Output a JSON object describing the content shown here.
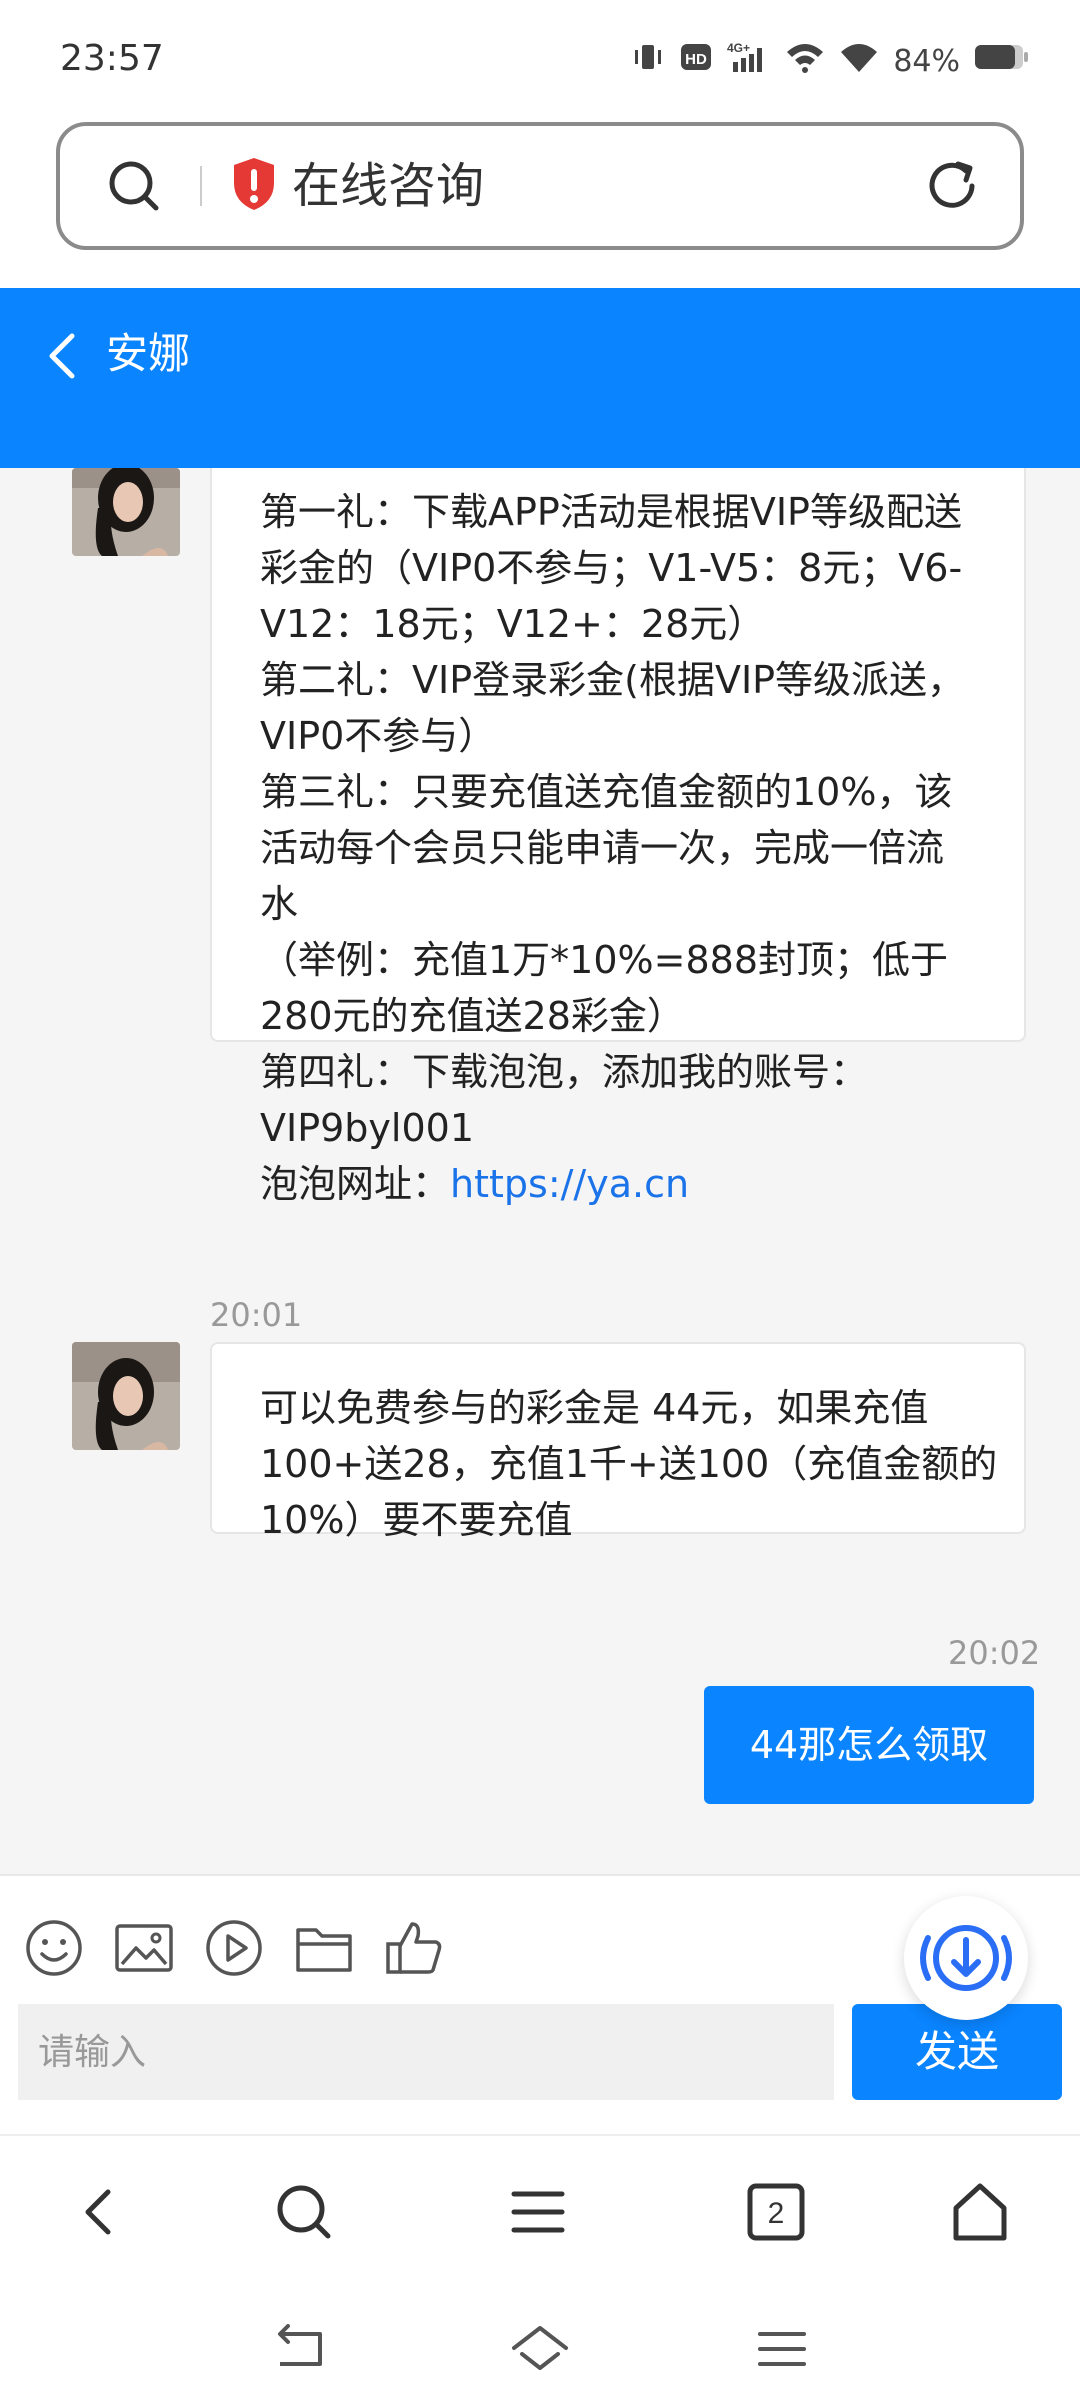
{
  "status_bar": {
    "time": "23:57",
    "battery": "84%",
    "network": "4G+",
    "hd": "HD"
  },
  "address_bar": {
    "title": "在线咨询"
  },
  "header": {
    "agent_name": "安娜"
  },
  "messages": {
    "msg1": {
      "lines": [
        "第一礼：下载APP活动是根据VIP等级配送",
        "彩金的（VIP0不参与；V1-V5：8元；V6-",
        "V12：18元；V12+：28元）",
        "第二礼：VIP登录彩金(根据VIP等级派送，",
        "VIP0不参与）",
        "第三礼：只要充值送充值金额的10%，该",
        "活动每个会员只能申请一次，完成一倍流",
        "水",
        "（举例：充值1万*10%=888封顶；低于",
        "280元的充值送28彩金）",
        "第四礼：下载泡泡，添加我的账号：",
        "VIP9byl001"
      ],
      "url_label": "泡泡网址：",
      "url": "https://ya.cn"
    },
    "msg2": {
      "time": "20:01",
      "lines": [
        "可以免费参与的彩金是 44元，如果充值",
        "100+送28，充值1千+送100（充值金额的",
        "10%）要不要充值"
      ]
    },
    "msg3": {
      "time": "20:02",
      "text": "44那怎么领取"
    }
  },
  "composer": {
    "placeholder": "请输入",
    "send_label": "发送",
    "tools": [
      "emoji-icon",
      "image-icon",
      "video-icon",
      "folder-icon",
      "thumbs-up-icon"
    ]
  },
  "browser_nav": {
    "tab_count": "2"
  },
  "colors": {
    "accent": "#0a84ff",
    "link": "#1a73e8",
    "shield": "#e53935"
  }
}
